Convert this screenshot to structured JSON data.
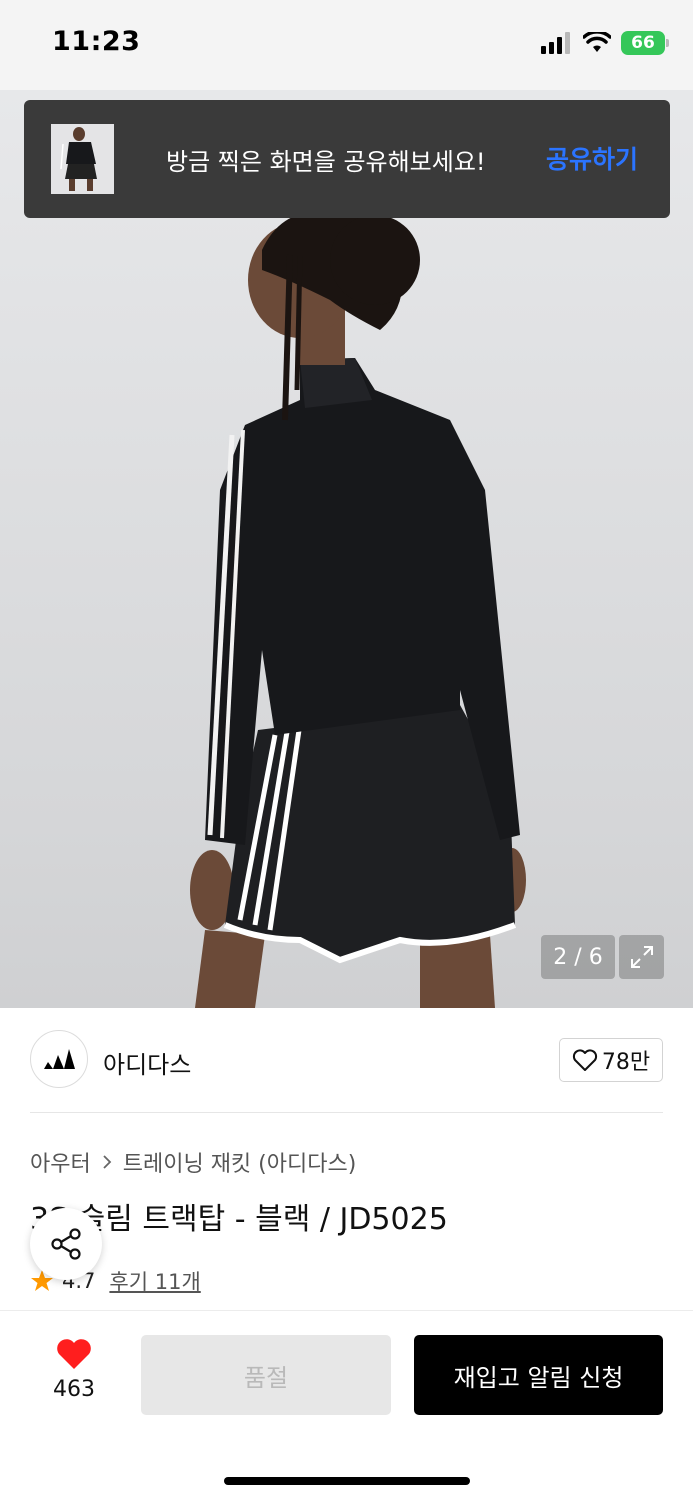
{
  "status_bar": {
    "time": "11:23",
    "battery": "66",
    "icons": [
      "signal-icon",
      "wifi-icon",
      "battery-icon"
    ]
  },
  "toast": {
    "message": "방금 찍은 화면을 공유해보세요!",
    "action": "공유하기"
  },
  "gallery": {
    "counter": "2 / 6",
    "icons": [
      "expand-icon"
    ]
  },
  "brand": {
    "name": "아디다스",
    "likes": "78만",
    "icons": [
      "adidas-logo-icon",
      "heart-outline-icon"
    ]
  },
  "breadcrumb": {
    "category": "아우터",
    "subcategory": "트레이닝 재킷 (아디다스)"
  },
  "product": {
    "title": "3S 슬림 트랙탑 - 블랙 / JD5025",
    "rating": "4.7",
    "reviews": "후기 11개"
  },
  "bottom_bar": {
    "wish_count": "463",
    "soldout_label": "품절",
    "restock_label": "재입고 알림 신청"
  },
  "colors": {
    "accent_blue": "#2b74ff",
    "heart_red": "#ff1e1e",
    "star_orange": "#ff9900",
    "toast_bg": "#3a3a3a",
    "battery_green": "#35c759"
  }
}
